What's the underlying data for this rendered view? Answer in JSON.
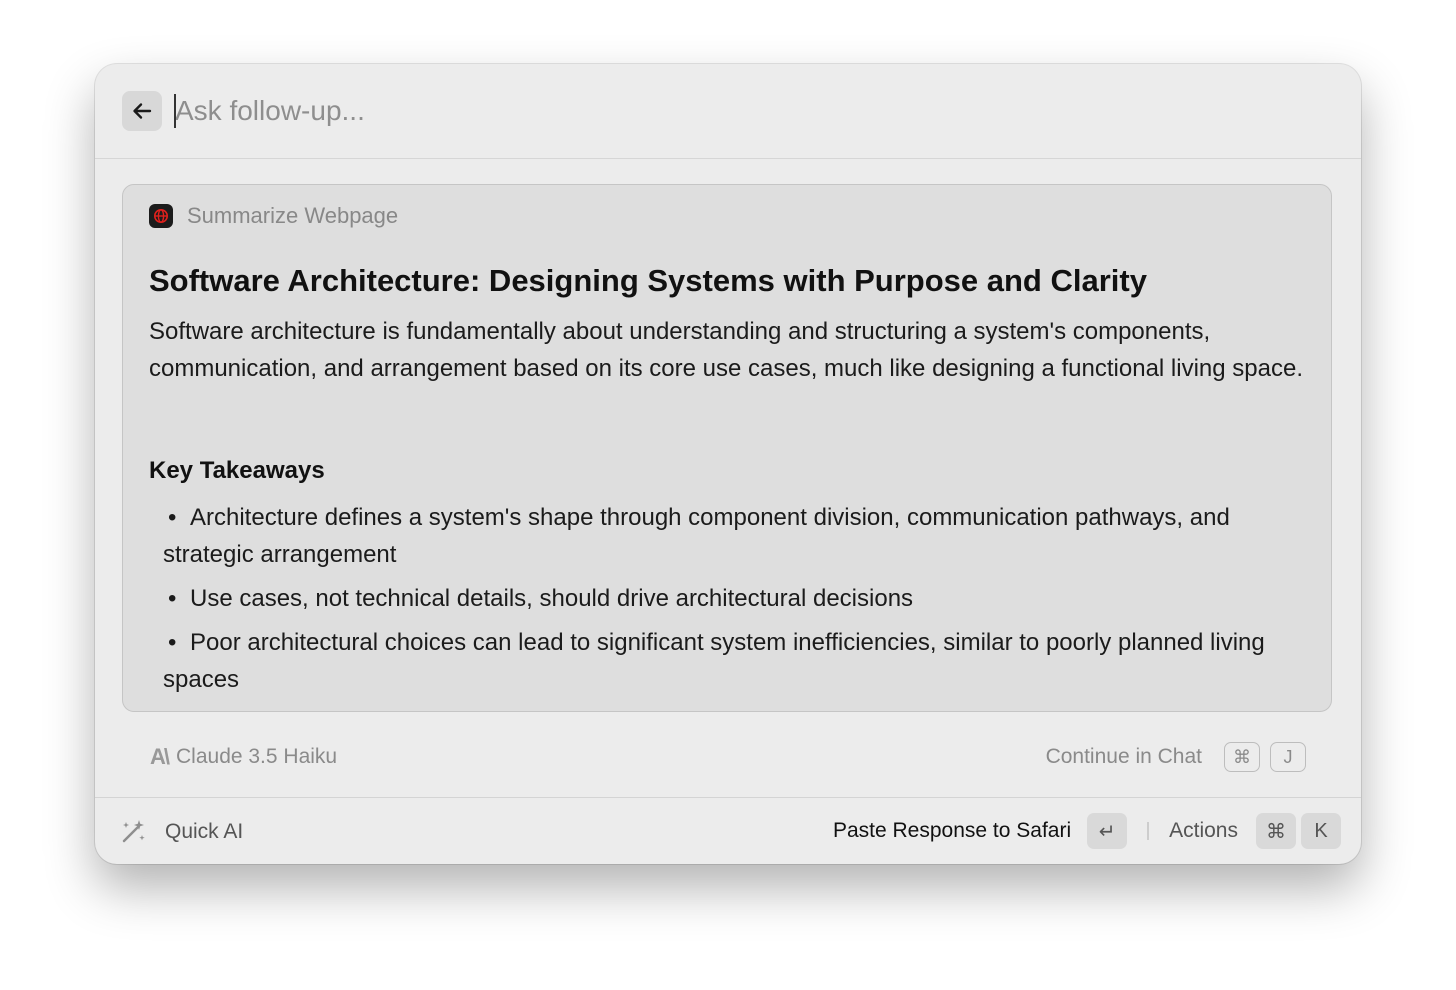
{
  "search": {
    "placeholder": "Ask follow-up..."
  },
  "card": {
    "command_title": "Summarize Webpage",
    "article_title": "Software Architecture: Designing Systems with Purpose and Clarity",
    "summary": "Software architecture is fundamentally about understanding and structuring a system's components, communication, and arrangement based on its core use cases, much like designing a functional living space.",
    "takeaways_heading": "Key Takeaways",
    "takeaways": [
      "Architecture defines a system's shape through component division, communication pathways, and strategic arrangement",
      "Use cases, not technical details, should drive architectural decisions",
      "Poor architectural choices can lead to significant system inefficiencies, similar to poorly planned living spaces"
    ]
  },
  "model_row": {
    "model_name": "Claude 3.5 Haiku",
    "continue_label": "Continue in Chat",
    "continue_keys": [
      "⌘",
      "J"
    ]
  },
  "bottom_bar": {
    "quick_ai_label": "Quick AI",
    "paste_label": "Paste Response to Safari",
    "paste_key": "↵",
    "actions_label": "Actions",
    "actions_keys": [
      "⌘",
      "K"
    ]
  },
  "icons": {
    "back": "arrow-left-icon",
    "command": "globe-icon",
    "model": "anthropic-icon",
    "quick_ai": "sparkle-icon"
  },
  "colors": {
    "command_icon_bg": "#1c1c1c",
    "command_icon_accent": "#e0211d"
  }
}
